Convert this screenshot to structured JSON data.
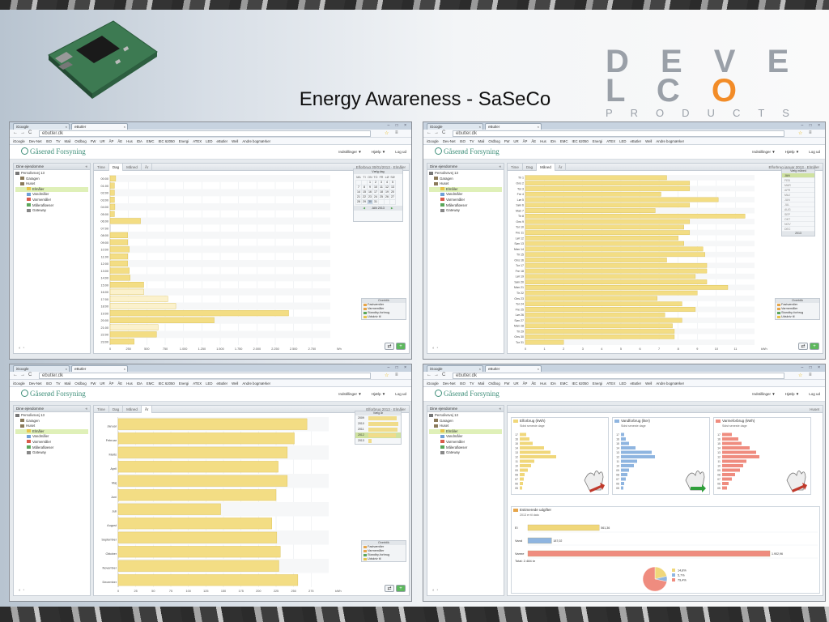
{
  "slide": {
    "title": "Energy Awareness - SaSeCo",
    "logo_word": "DEVELCO",
    "logo_sub": "PRODUCTS"
  },
  "browser": {
    "tab_inactive": "iGoogle",
    "tab_active": "eButler",
    "url": "ebutler.dk",
    "bookmarks": [
      "iGoogle",
      "Dev-Net",
      "ISO",
      "TV",
      "Mail",
      "Ordbog",
      "FW",
      "UR",
      "ÅP",
      "ÅE",
      "Hus",
      "IDA",
      "EMC",
      "IEC 62050",
      "Energi",
      "ATEX",
      "LED",
      "eButler",
      "Well",
      "Andre bogmærker"
    ]
  },
  "app": {
    "brand": "Gåserød Forsyning",
    "nav": {
      "settings": "Indstillinger ▼",
      "help": "Hjælp ▼",
      "logout": "Log ud"
    },
    "left_header": "Dine ejendomme",
    "tree": [
      "Persolivsvej 13",
      "Garagen",
      "Huset",
      "Elmåler",
      "Vandmåler",
      "Varmemåler",
      "Målerafløeser",
      "Gateway"
    ],
    "tabs": [
      "Time",
      "Dag",
      "Måned",
      "År"
    ],
    "side_box_title": "Overblik",
    "side_box": [
      "Elmåler",
      "Fastværdier",
      "Varmemåler",
      "Standby-forbrug",
      "Udskriv til"
    ]
  },
  "panel_day": {
    "header_right": "Elforbrug 30/01/2013 · Elmåler",
    "calendar": {
      "title": "Vælg dag",
      "weekdays": [
        "MA",
        "TI",
        "ON",
        "TO",
        "FR",
        "LØ",
        "SØ"
      ],
      "days": [
        [
          "",
          "",
          "1",
          "2",
          "3",
          "4",
          "5"
        ],
        [
          "7",
          "8",
          "9",
          "10",
          "11",
          "12",
          "13"
        ],
        [
          "14",
          "15",
          "16",
          "17",
          "18",
          "19",
          "20"
        ],
        [
          "21",
          "22",
          "23",
          "24",
          "25",
          "26",
          "27"
        ],
        [
          "28",
          "29",
          "30",
          "31",
          "",
          "",
          ""
        ]
      ],
      "month_label": "JAN 2013"
    },
    "chart_data": {
      "type": "bar",
      "orientation": "horizontal",
      "categories": [
        "00:00",
        "01:00",
        "02:00",
        "03:00",
        "04:00",
        "05:00",
        "06:00",
        "07:00",
        "08:00",
        "09:00",
        "10:00",
        "11:00",
        "12:00",
        "13:00",
        "14:00",
        "15:00",
        "16:00",
        "17:00",
        "18:00",
        "19:00",
        "20:00",
        "21:00",
        "22:00",
        "23:00"
      ],
      "values": [
        70,
        55,
        55,
        55,
        60,
        55,
        380,
        0,
        220,
        220,
        240,
        220,
        220,
        240,
        250,
        420,
        420,
        720,
        820,
        2230,
        1300,
        600,
        580,
        300
      ],
      "xlim": [
        0,
        2750
      ],
      "xticks": [
        "0",
        "250",
        "500",
        "750",
        "1.000",
        "1.250",
        "1.500",
        "1.750",
        "2.000",
        "2.250",
        "2.500",
        "2.750"
      ],
      "xunit": "Wh"
    }
  },
  "panel_month": {
    "header_right": "Elforbrug januar 2013 · Elmåler",
    "month_box": {
      "title": "Vælg måned",
      "months": [
        "JAN",
        "FEB",
        "MAR",
        "APR",
        "MAJ",
        "JUN",
        "JUL",
        "AUG",
        "SEP",
        "OKT",
        "NOV",
        "DEC"
      ],
      "year": "2013"
    },
    "chart_data": {
      "type": "bar",
      "orientation": "horizontal",
      "categories": [
        "Tir 1",
        "Ons 2",
        "Tor 3",
        "Fre 4",
        "Lør 5",
        "Søn 6",
        "Man 7",
        "Tir 8",
        "Ons 9",
        "Tor 10",
        "Fre 11",
        "Lør 12",
        "Søn 13",
        "Man 14",
        "Tir 15",
        "Ons 16",
        "Tor 17",
        "Fre 18",
        "Lør 19",
        "Søn 20",
        "Man 21",
        "Tir 22",
        "Ons 23",
        "Tor 24",
        "Fre 25",
        "Lør 26",
        "Søn 27",
        "Man 28",
        "Tir 29",
        "Ons 30",
        "Tor 31"
      ],
      "values": [
        7.4,
        8.6,
        8.6,
        7.1,
        10.1,
        8.6,
        6.8,
        11.5,
        8.6,
        8.3,
        8.6,
        8.0,
        8.3,
        9.3,
        9.4,
        7.4,
        9.5,
        9.5,
        8.9,
        9.5,
        10.6,
        9.0,
        6.9,
        8.2,
        8.9,
        7.3,
        8.2,
        7.7,
        7.8,
        7.8,
        2.0
      ],
      "xlim": [
        0,
        12
      ],
      "xticks": [
        "0",
        "1",
        "2",
        "3",
        "4",
        "5",
        "6",
        "7",
        "8",
        "9",
        "10",
        "11"
      ],
      "xunit": "kWh"
    }
  },
  "panel_year": {
    "header_right": "Elforbrug 2013 · Elmåler",
    "year_box": {
      "title": "Vælg år",
      "years": [
        "2009",
        "2010",
        "2011",
        "2012",
        "2013"
      ],
      "values": [
        250,
        260,
        255,
        245,
        30
      ]
    },
    "chart_data": {
      "type": "bar",
      "orientation": "horizontal",
      "categories": [
        "Januar",
        "Februar",
        "Marts",
        "April",
        "Maj",
        "Juni",
        "Juli",
        "August",
        "September",
        "Oktober",
        "November",
        "December"
      ],
      "values": [
        269,
        251,
        241,
        228,
        241,
        225,
        146,
        219,
        226,
        231,
        229,
        256
      ],
      "xlim": [
        0,
        300
      ],
      "xticks": [
        "0",
        "25",
        "50",
        "75",
        "100",
        "125",
        "150",
        "175",
        "200",
        "225",
        "250",
        "275"
      ],
      "xunit": "kWh"
    }
  },
  "panel_overview": {
    "header_right": "Huset",
    "boxes": [
      {
        "title": "Elforbrug (kWh)",
        "sub": "Sidst seneste dage",
        "color": "#f0d77a"
      },
      {
        "title": "Vandforbrug (liter)",
        "sub": "Sidst seneste dage",
        "color": "#8fb5e0"
      },
      {
        "title": "Varmeforbrug (kWh)",
        "sub": "Sidst seneste dage",
        "color": "#ef8c7f"
      }
    ],
    "mini_rows": [
      "17",
      "16",
      "15",
      "14",
      "13",
      "12",
      "11",
      "10",
      "09",
      "08",
      "07",
      "06",
      "05"
    ],
    "mini_values": {
      "el": [
        8,
        12,
        16,
        30,
        38,
        45,
        18,
        14,
        10,
        6,
        5,
        4,
        3
      ],
      "water": [
        4,
        6,
        10,
        18,
        38,
        42,
        20,
        16,
        10,
        8,
        6,
        4,
        3
      ],
      "heat": [
        12,
        20,
        24,
        34,
        42,
        46,
        30,
        26,
        22,
        16,
        12,
        8,
        6
      ]
    },
    "estimate": {
      "title": "Estimerede udgifter",
      "subtitle": "2013 er til dato",
      "rows": [
        {
          "label": "El",
          "value_label": "561,36",
          "value": 561.36,
          "color": "#f0d77a"
        },
        {
          "label": "Vand",
          "value_label": "187,02",
          "value": 187.02,
          "color": "#8fb5e0"
        },
        {
          "label": "Varme",
          "value_label": "1.902,96",
          "value": 1902.96,
          "color": "#ef8c7f"
        }
      ],
      "total": "Total: 2.484 kr",
      "pie_legend": [
        "14,8%",
        "5,7%",
        "79,4%"
      ]
    }
  }
}
